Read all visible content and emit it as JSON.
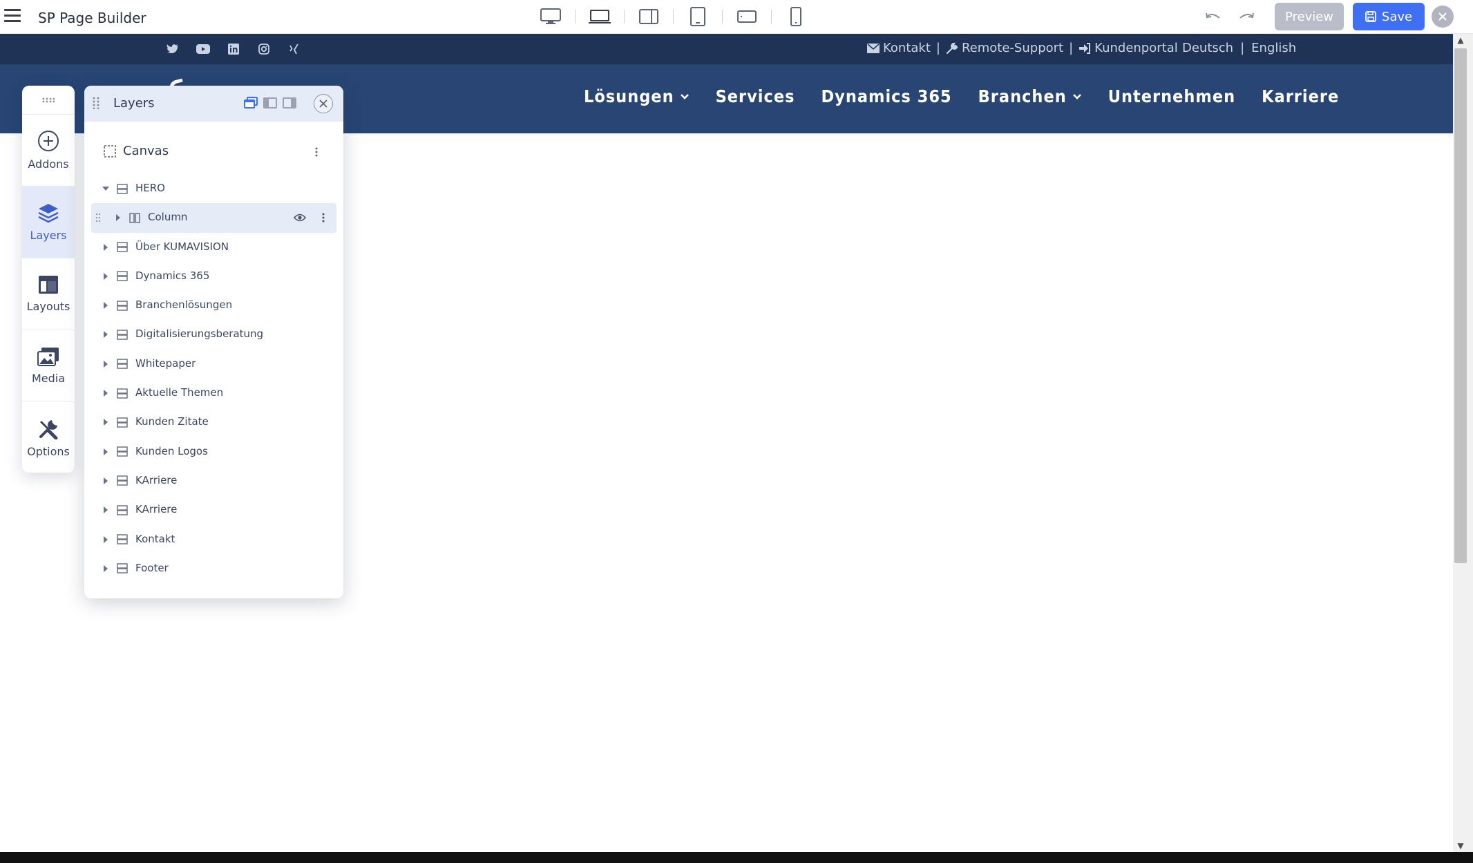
{
  "app": {
    "title": "SP Page Builder",
    "preview_label": "Preview",
    "save_label": "Save"
  },
  "device_modes": [
    "desktop",
    "laptop",
    "tablet-landscape",
    "tablet",
    "mobile-landscape",
    "mobile"
  ],
  "active_device": "laptop",
  "site": {
    "top_links": {
      "kontakt": "Kontakt",
      "remote": "Remote-Support",
      "portal": "Kundenportal",
      "separator": "|"
    },
    "languages": {
      "de": "Deutsch",
      "sep": "|",
      "en": "English"
    },
    "nav": [
      {
        "label": "Lösungen",
        "dropdown": true
      },
      {
        "label": "Services",
        "dropdown": false
      },
      {
        "label": "Dynamics 365",
        "dropdown": false
      },
      {
        "label": "Branchen",
        "dropdown": true
      },
      {
        "label": "Unternehmen",
        "dropdown": false
      },
      {
        "label": "Karriere",
        "dropdown": false
      }
    ],
    "social": [
      "twitter-icon",
      "youtube-icon",
      "linkedin-icon",
      "instagram-icon",
      "xing-icon"
    ]
  },
  "sidebar": {
    "items": [
      {
        "label": "Addons",
        "icon": "plus-circle-icon"
      },
      {
        "label": "Layers",
        "icon": "layers-icon",
        "active": true
      },
      {
        "label": "Layouts",
        "icon": "layout-icon"
      },
      {
        "label": "Media",
        "icon": "media-icon"
      },
      {
        "label": "Options",
        "icon": "tools-icon"
      }
    ]
  },
  "layers": {
    "title": "Layers",
    "canvas_label": "Canvas",
    "rows": [
      {
        "label": "HERO",
        "expanded": true,
        "level": 0
      },
      {
        "label": "Column",
        "level": 1,
        "selected": true
      },
      {
        "label": "Über KUMAVISION",
        "level": 0
      },
      {
        "label": "Dynamics 365",
        "level": 0
      },
      {
        "label": "Branchenlösungen",
        "level": 0
      },
      {
        "label": "Digitalisierungsberatung",
        "level": 0
      },
      {
        "label": "Whitepaper",
        "level": 0
      },
      {
        "label": "Aktuelle Themen",
        "level": 0
      },
      {
        "label": "Kunden Zitate",
        "level": 0
      },
      {
        "label": "Kunden Logos",
        "level": 0
      },
      {
        "label": "KArriere",
        "level": 0
      },
      {
        "label": "KArriere",
        "level": 0
      },
      {
        "label": "Kontakt",
        "level": 0
      },
      {
        "label": "Footer",
        "level": 0
      }
    ]
  },
  "colors": {
    "accent": "#3f6ff2",
    "site_topbar": "#1f3356",
    "site_nav": "#284574",
    "panel_header": "#e6ebf8"
  }
}
